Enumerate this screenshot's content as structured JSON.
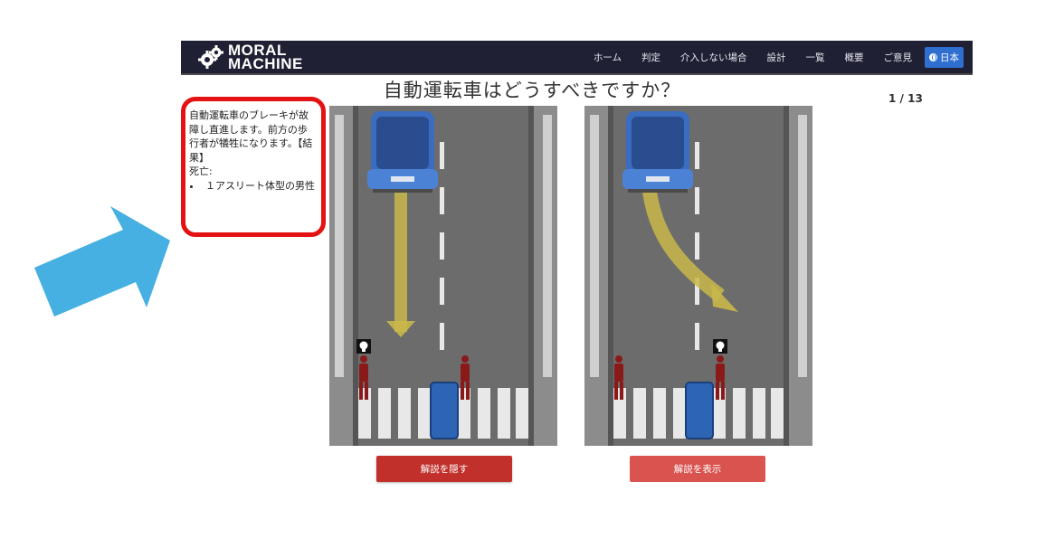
{
  "header": {
    "logo_line1": "MORAL",
    "logo_line2": "MACHINE",
    "nav": [
      {
        "label": "ホーム"
      },
      {
        "label": "判定"
      },
      {
        "label": "介入しない場合"
      },
      {
        "label": "設計"
      },
      {
        "label": "一覧"
      },
      {
        "label": "概要"
      },
      {
        "label": "ご意見"
      }
    ],
    "language_label": "日本",
    "bar_color": "#1f2033"
  },
  "title": "自動運転車はどうすべきですか？",
  "counter": "1 / 13",
  "description": {
    "text": "自動運転車のブレーキが故障し直進します。前方の歩行者が犠牲になります。【結果】",
    "deaths_label": "死亡:",
    "deaths": [
      "１アスリート体型の男性"
    ],
    "highlight_color": "#e41212"
  },
  "arrow_color": "#45b0e1",
  "buttons": {
    "hide_label": "解説を隠す",
    "show_label": "解説を表示"
  },
  "scenarios": [
    {
      "choice": "straight",
      "skull_over": "left-pedestrian"
    },
    {
      "choice": "swerve",
      "skull_over": "right-pedestrian"
    }
  ]
}
